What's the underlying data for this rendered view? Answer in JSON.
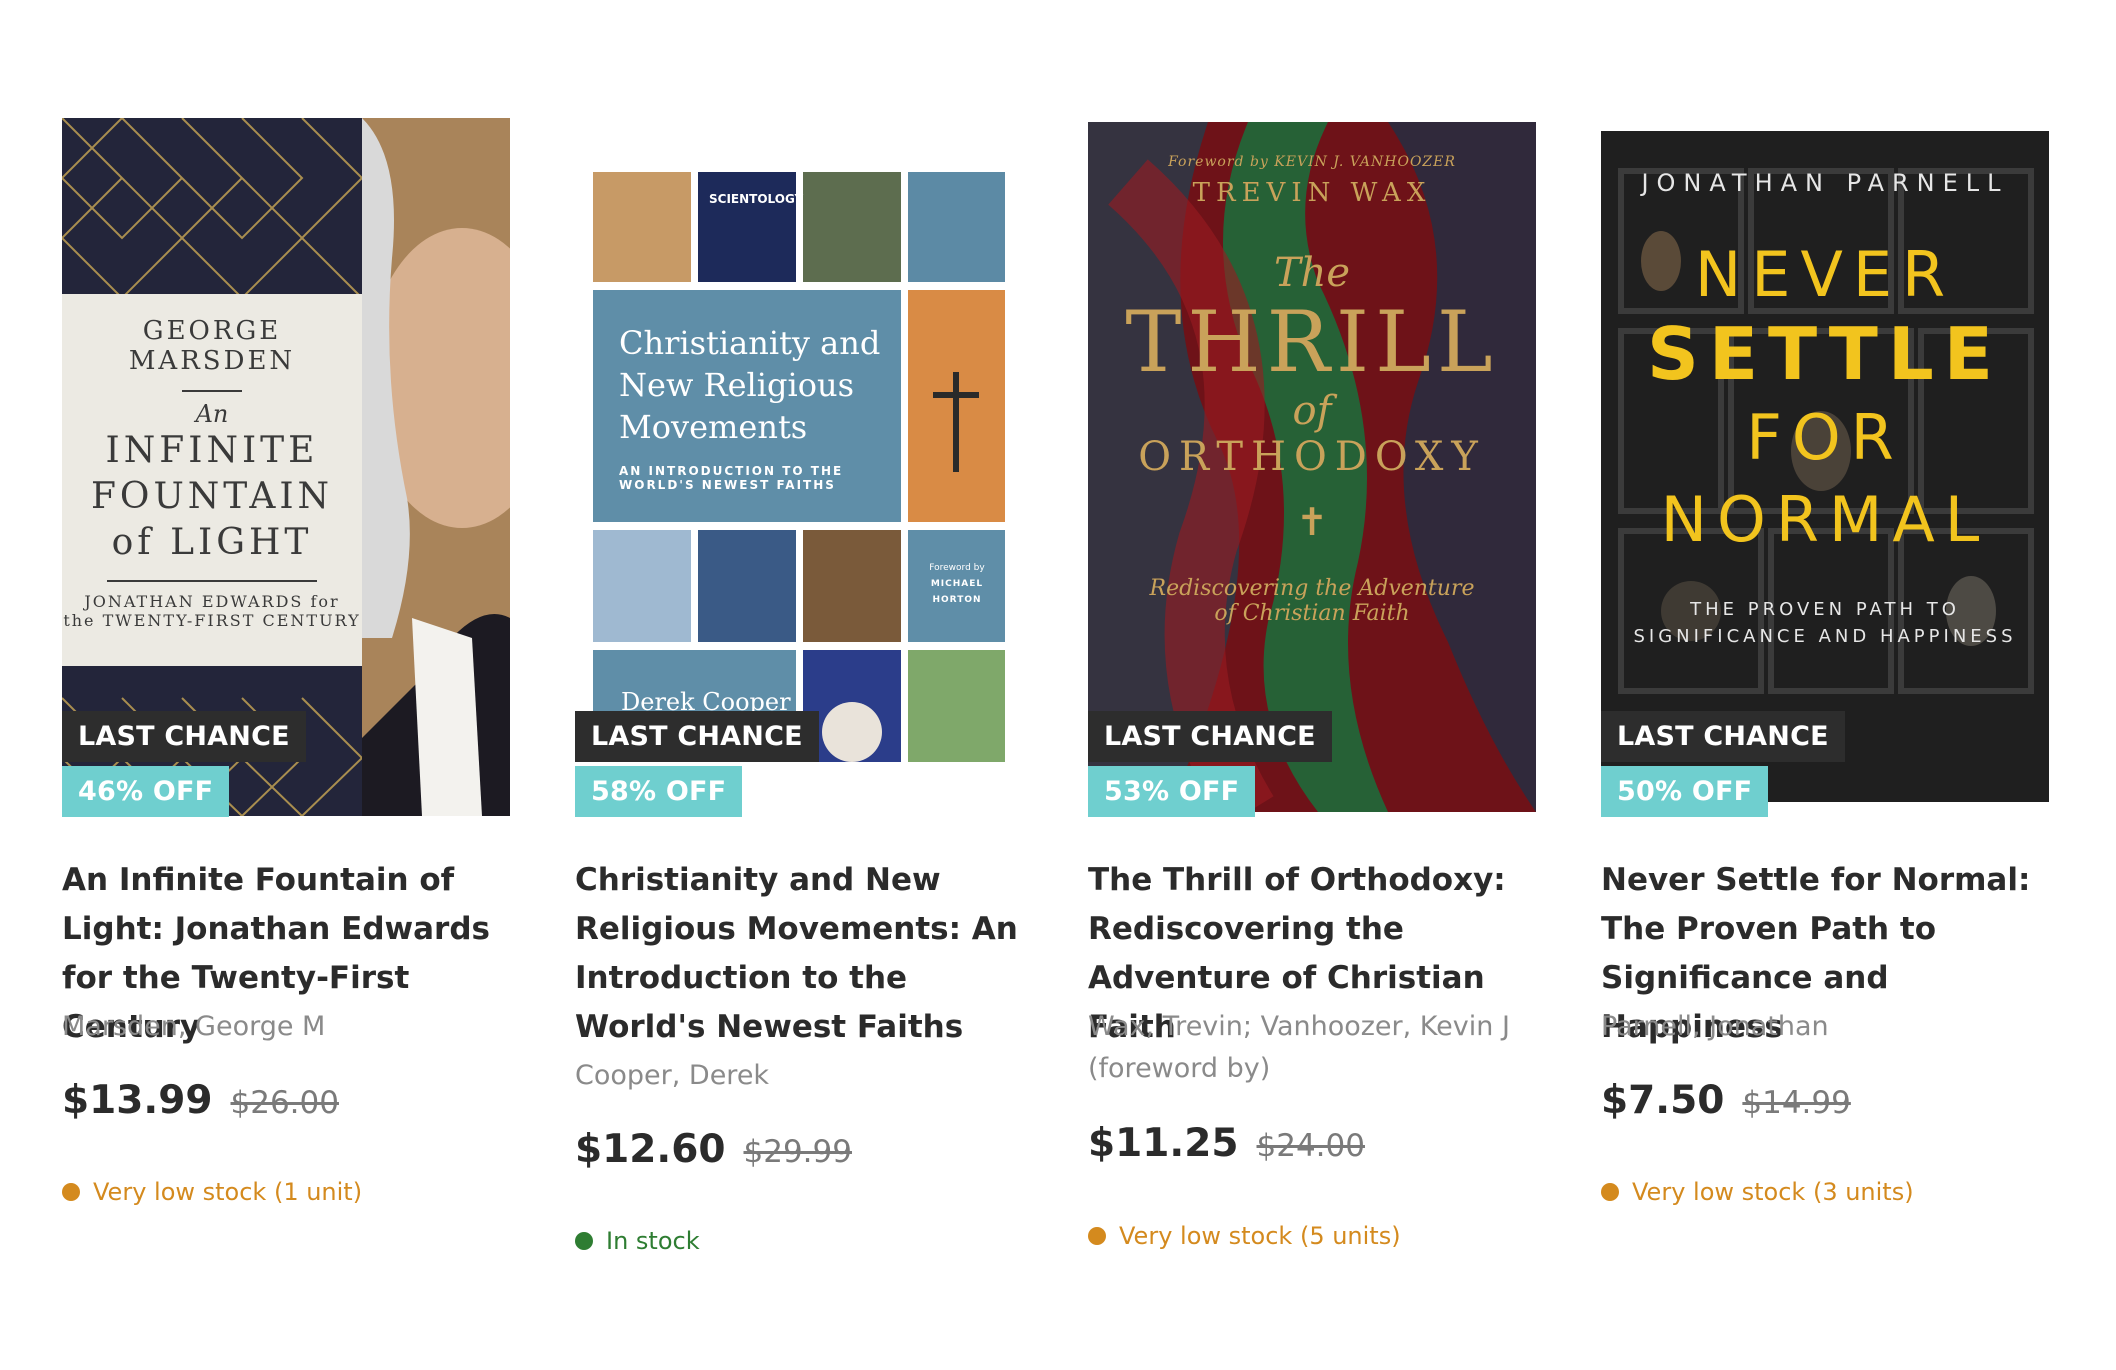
{
  "products": [
    {
      "badge_last": "LAST CHANCE",
      "badge_off": "46% OFF",
      "title": "An Infinite Fountain of Light: Jonathan Edwards for the Twenty-First Century",
      "author": "Marsden, George M",
      "price": "$13.99",
      "old_price": "$26.00",
      "stock": "Very low stock (1 unit)",
      "cover": {
        "author": "GEORGE MARSDEN",
        "line1": "An",
        "line2": "INFINITE",
        "line3": "FOUNTAIN",
        "line4": "of LIGHT",
        "sub1": "JONATHAN EDWARDS for",
        "sub2": "the TWENTY-FIRST CENTURY"
      }
    },
    {
      "badge_last": "LAST CHANCE",
      "badge_off": "58% OFF",
      "title": "Christianity and New Religious Movements: An Introduction to the World's Newest Faiths",
      "author": "Cooper, Derek",
      "price": "$12.60",
      "old_price": "$29.99",
      "stock": "In stock",
      "cover": {
        "title1": "Christianity and",
        "title2": "New Religious",
        "title3": "Movements",
        "sub1": "AN INTRODUCTION TO THE",
        "sub2": "WORLD'S NEWEST FAITHS",
        "foreword1": "Foreword by",
        "foreword2": "MICHAEL",
        "foreword3": "HORTON",
        "author": "Derek Cooper",
        "sign": "SCIENTOLOGY"
      }
    },
    {
      "badge_last": "LAST CHANCE",
      "badge_off": "53% OFF",
      "title": "The Thrill of Orthodoxy: Rediscovering the Adventure of Christian Faith",
      "author": "Wax, Trevin; Vanhoozer, Kevin J (foreword by)",
      "price": "$11.25",
      "old_price": "$24.00",
      "stock": "Very low stock (5 units)",
      "cover": {
        "foreword": "Foreword by KEVIN J. VANHOOZER",
        "author": "TREVIN WAX",
        "the": "The",
        "thrill": "THRILL",
        "of": "of",
        "orthodoxy": "ORTHODOXY",
        "sub1": "Rediscovering the Adventure",
        "sub2": "of Christian Faith"
      }
    },
    {
      "badge_last": "LAST CHANCE",
      "badge_off": "50% OFF",
      "title": "Never Settle for Normal: The Proven Path to Significance and Happiness",
      "author": "Parnell, Jonathan",
      "price": "$7.50",
      "old_price": "$14.99",
      "stock": "Very low stock (3 units)",
      "cover": {
        "author": "JONATHAN PARNELL",
        "line1": "NEVER",
        "line2": "SETTLE",
        "line3": "FOR",
        "line4": "NORMAL",
        "sub1": "THE PROVEN PATH TO",
        "sub2": "SIGNIFICANCE AND HAPPINESS"
      }
    }
  ]
}
